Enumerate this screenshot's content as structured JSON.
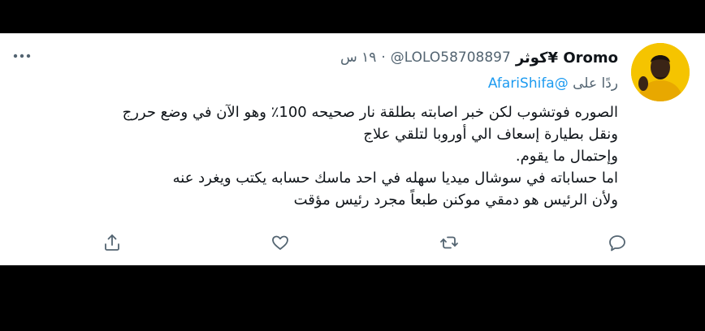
{
  "tweet": {
    "display_name": "كوثر¥ Oromo",
    "handle": "@LOLO58708897",
    "separator": "·",
    "time": "١٩ س",
    "replying_prefix": "ردًا على",
    "replying_to": "@AfariShifa",
    "body_lines": [
      "الصوره فوتشوب لكن خبر اصابته بطلقة نار صحيحه 100٪ وهو الآن في وضع حررج",
      "ونقل بطيارة إسعاف الي أوروبا لتلقي علاج",
      "وإحتمال ما يقوم.",
      "اما حساباته في سوشال ميديا سهله في احد ماسك حسابه يكتب ويغرد عنه",
      "ولأن الرئيس هو دمقي موكنن طبعاً مجرد رئيس مؤقت"
    ]
  },
  "icons": {
    "more": "more-horizontal-icon",
    "reply": "reply-icon",
    "retweet": "retweet-icon",
    "like": "like-icon",
    "share": "share-icon"
  },
  "colors": {
    "text_primary": "#0f1419",
    "text_secondary": "#536471",
    "link": "#1d9bf0",
    "avatar_bg": "#f5c400"
  }
}
